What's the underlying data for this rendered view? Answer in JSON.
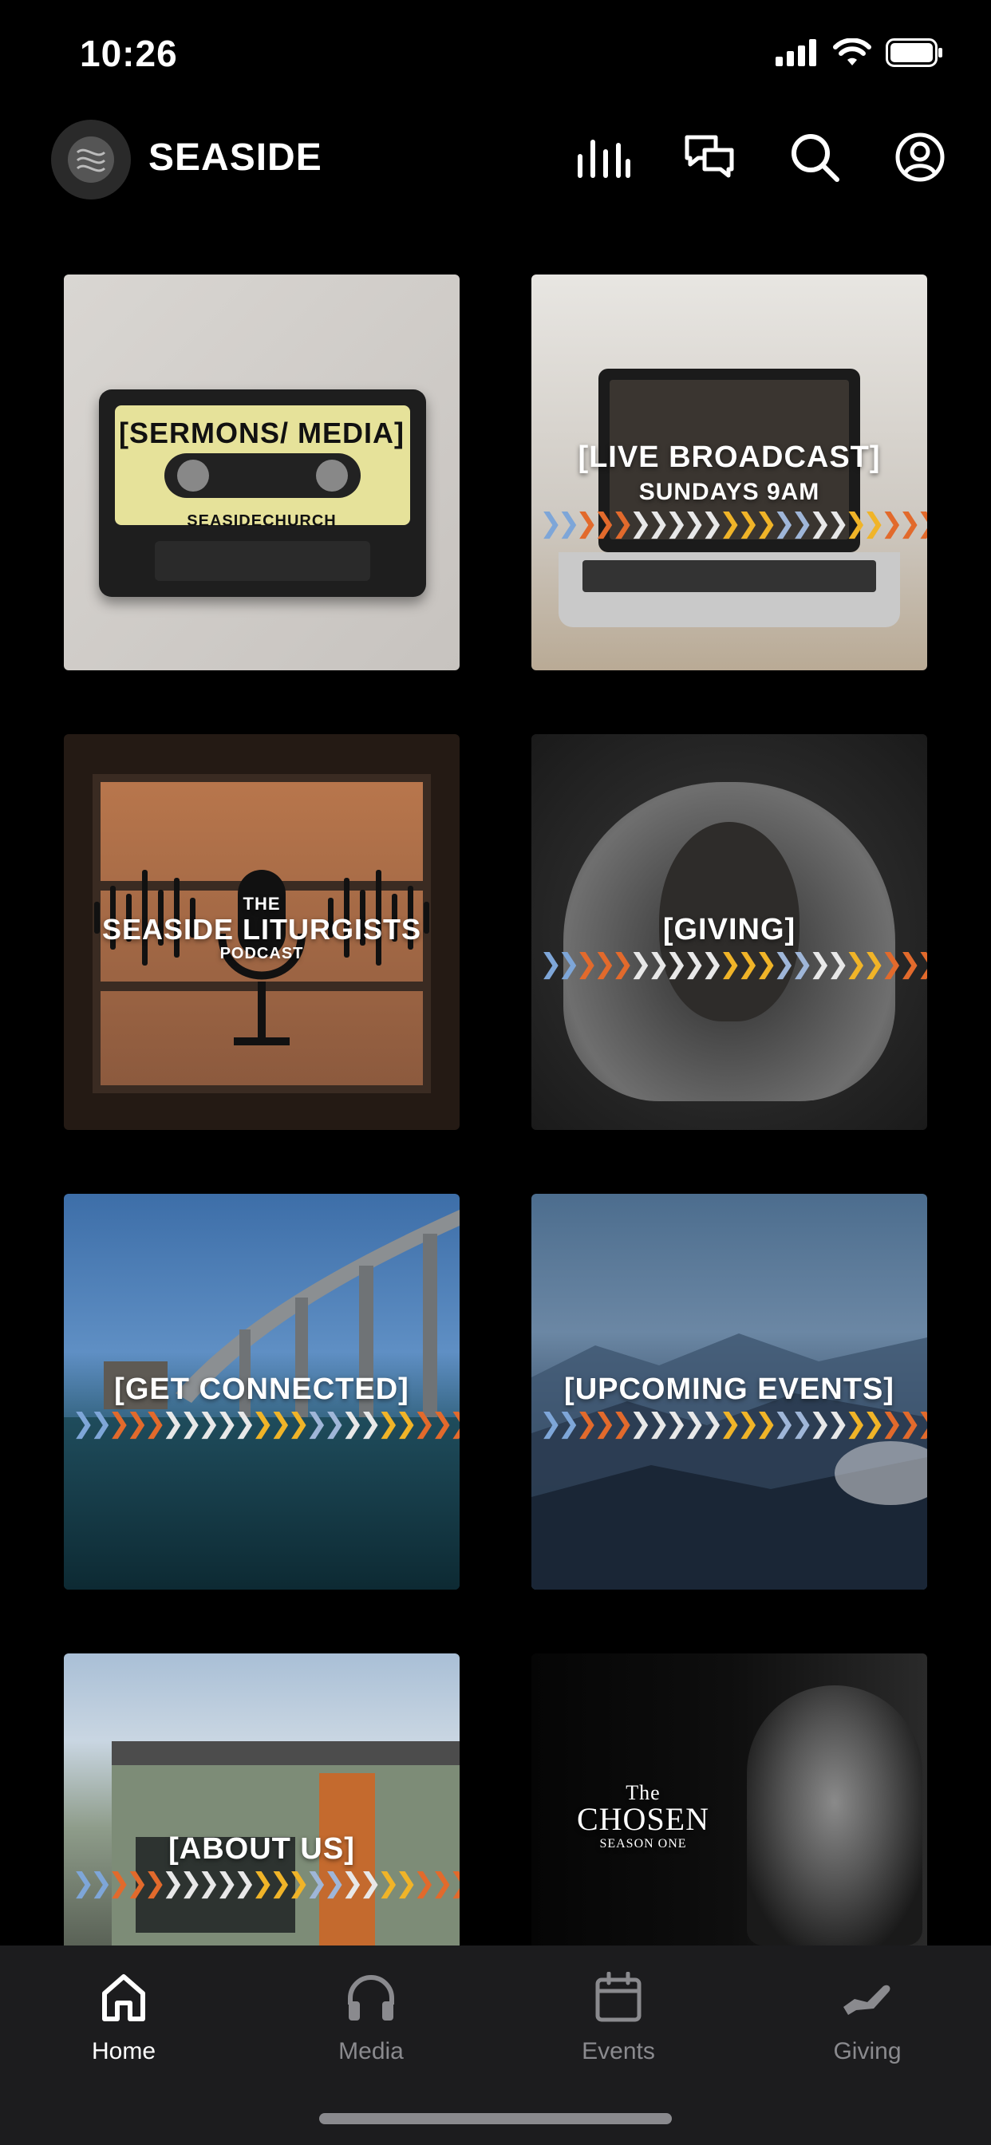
{
  "status": {
    "time": "10:26"
  },
  "header": {
    "title": "SEASIDE"
  },
  "tiles": {
    "sermons": {
      "label": "[SERMONS/ MEDIA]",
      "sublabel": "SEASIDECHURCH"
    },
    "live": {
      "label": "[LIVE BROADCAST]",
      "sublabel": "SUNDAYS 9AM"
    },
    "podcast": {
      "pre": "THE",
      "label": "SEASIDE LITURGISTS",
      "sublabel": "PODCAST"
    },
    "giving": {
      "label": "[GIVING]"
    },
    "connected": {
      "label": "[GET CONNECTED]"
    },
    "events": {
      "label": "[UPCOMING EVENTS]"
    },
    "about": {
      "label": "[ABOUT US]"
    },
    "chosen": {
      "pre": "The",
      "label": "CHOSEN",
      "sublabel": "SEASON ONE"
    }
  },
  "nav": {
    "items": [
      {
        "label": "Home",
        "icon": "home-icon",
        "active": true
      },
      {
        "label": "Media",
        "icon": "headphones-icon",
        "active": false
      },
      {
        "label": "Events",
        "icon": "calendar-icon",
        "active": false
      },
      {
        "label": "Giving",
        "icon": "giving-icon",
        "active": false
      }
    ]
  },
  "colors": {
    "background": "#000000",
    "nav_background": "#1c1c1e",
    "inactive": "#8a8a8e"
  }
}
